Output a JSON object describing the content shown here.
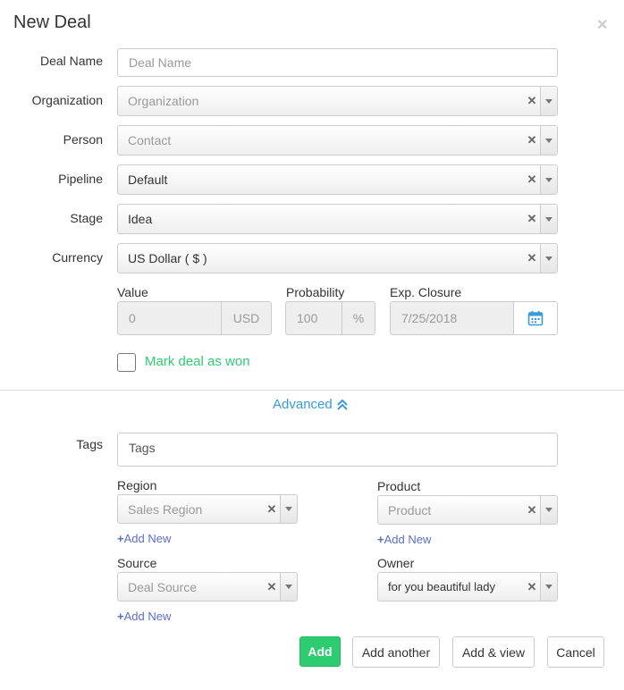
{
  "dialog": {
    "title": "New Deal"
  },
  "fields": {
    "deal_name": {
      "label": "Deal Name",
      "placeholder": "Deal Name"
    },
    "organization": {
      "label": "Organization",
      "placeholder": "Organization"
    },
    "person": {
      "label": "Person",
      "placeholder": "Contact"
    },
    "pipeline": {
      "label": "Pipeline",
      "value": "Default"
    },
    "stage": {
      "label": "Stage",
      "value": "Idea"
    },
    "currency": {
      "label": "Currency",
      "value": "US Dollar ( $ )"
    }
  },
  "value": {
    "label": "Value",
    "value": "0",
    "unit": "USD"
  },
  "probability": {
    "label": "Probability",
    "value": "100",
    "unit": "%"
  },
  "exp_closure": {
    "label": "Exp. Closure",
    "value": "7/25/2018"
  },
  "mark_won": {
    "label": "Mark deal as won",
    "color": "#2ecc71"
  },
  "advanced": {
    "label": "Advanced"
  },
  "tags": {
    "label": "Tags",
    "placeholder": "Tags"
  },
  "region": {
    "label": "Region",
    "placeholder": "Sales Region",
    "add_new": "Add New"
  },
  "product": {
    "label": "Product",
    "placeholder": "Product",
    "add_new": "Add New"
  },
  "source": {
    "label": "Source",
    "placeholder": "Deal Source",
    "add_new": "Add New"
  },
  "owner": {
    "label": "Owner",
    "value": "for you beautiful lady"
  },
  "buttons": {
    "add": "Add",
    "add_another": "Add another",
    "add_view": "Add & view",
    "cancel": "Cancel"
  },
  "colors": {
    "accent_green": "#2ecc71",
    "link_blue": "#3a9ad9",
    "add_new": "#5b6cc9"
  }
}
